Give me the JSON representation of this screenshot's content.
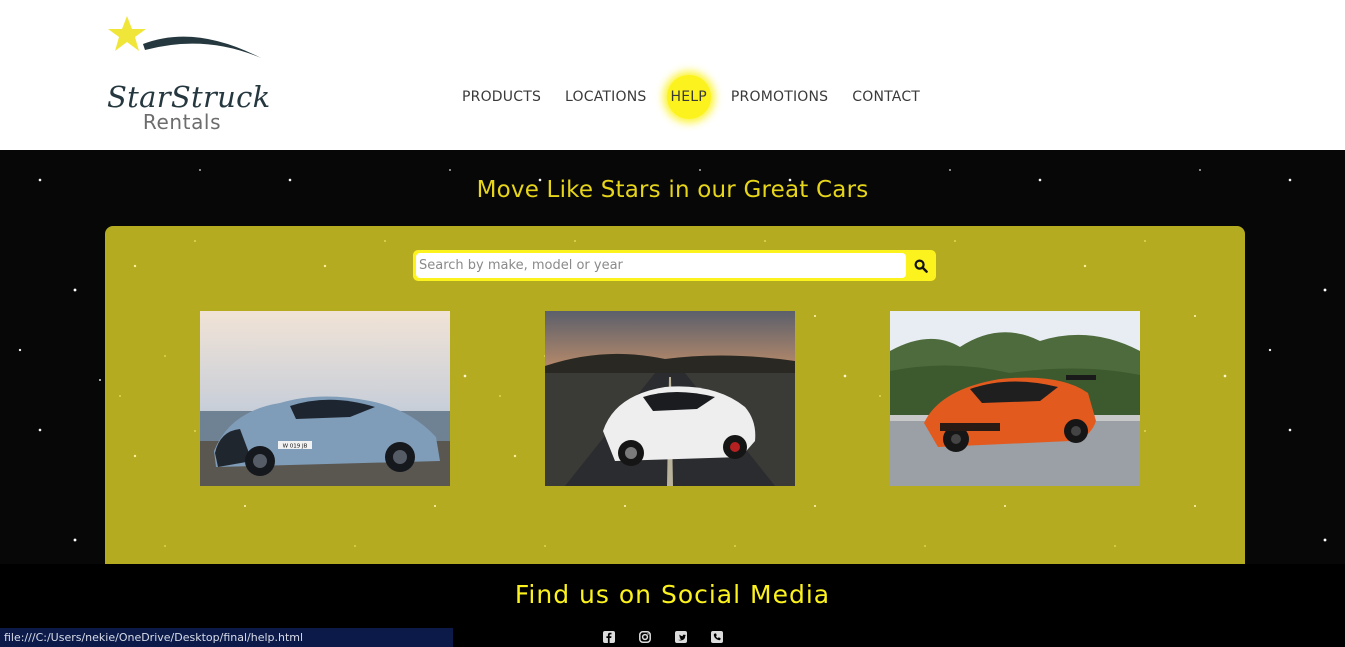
{
  "brand": {
    "name": "StarStruck",
    "subtitle": "Rentals",
    "accent_color": "#fcf21d",
    "dark_color": "#26383f"
  },
  "nav": {
    "items": [
      {
        "label": "PRODUCTS",
        "active": false
      },
      {
        "label": "LOCATIONS",
        "active": false
      },
      {
        "label": "HELP",
        "active": true
      },
      {
        "label": "PROMOTIONS",
        "active": false
      },
      {
        "label": "CONTACT",
        "active": false
      }
    ]
  },
  "hero": {
    "title": "Move Like Stars in our Great Cars",
    "title_color": "#e7d51a",
    "panel_color": "#b5ab21"
  },
  "search": {
    "placeholder": "Search by make, model or year",
    "value": "",
    "icon": "search-icon"
  },
  "cars": [
    {
      "name": "car-photo-blue-coupe",
      "plate": "W 019 JB",
      "body_color": "#7f9cb8"
    },
    {
      "name": "car-photo-white-sports-car",
      "body_color": "#eeeeee"
    },
    {
      "name": "car-photo-orange-sports-car",
      "body_color": "#e35a1e"
    }
  ],
  "footer": {
    "title": "Find us on Social Media",
    "social_icons": [
      "facebook-icon",
      "instagram-icon",
      "twitter-icon",
      "phone-icon"
    ]
  },
  "status_bar": {
    "url": "file:///C:/Users/nekie/OneDrive/Desktop/final/help.html"
  }
}
